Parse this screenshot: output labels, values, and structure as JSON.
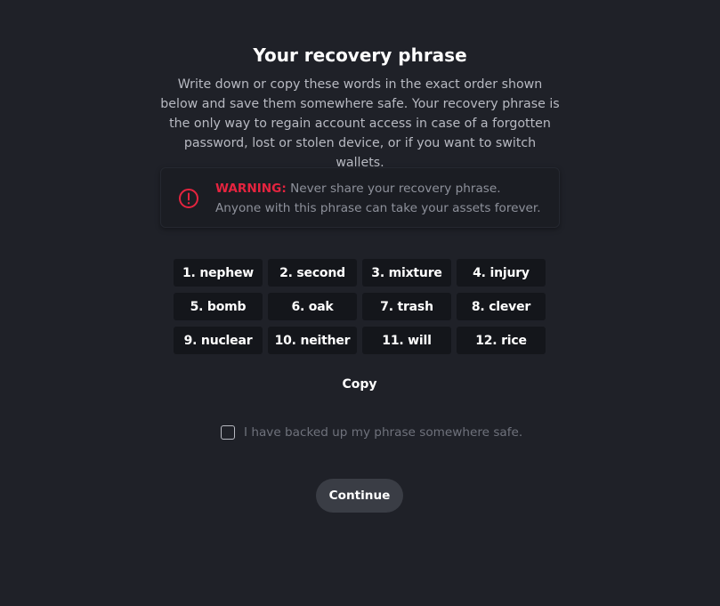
{
  "header": {
    "title": "Your recovery phrase",
    "description": "Write down or copy these words in the exact order shown below and save them somewhere safe. Your recovery phrase is the only way to regain account access in case of a forgotten password, lost or stolen device, or if you want to switch wallets."
  },
  "warning": {
    "icon": "alert-circle-icon",
    "color": "#e5243f",
    "label": "WARNING:",
    "line1": " Never share your recovery phrase.",
    "line2": "Anyone with this phrase can take your assets forever."
  },
  "phrase": {
    "words": [
      "1. nephew",
      "2. second",
      "3. mixture",
      "4. injury",
      "5. bomb",
      "6. oak",
      "7. trash",
      "8. clever",
      "9. nuclear",
      "10. neither",
      "11. will",
      "12. rice"
    ]
  },
  "actions": {
    "copy_label": "Copy",
    "checkbox_label": "I have backed up my phrase somewhere safe.",
    "checkbox_checked": false,
    "continue_label": "Continue"
  },
  "colors": {
    "background": "#1f2128",
    "accent_warning": "#e5243f",
    "button_background": "#3a3d45"
  }
}
